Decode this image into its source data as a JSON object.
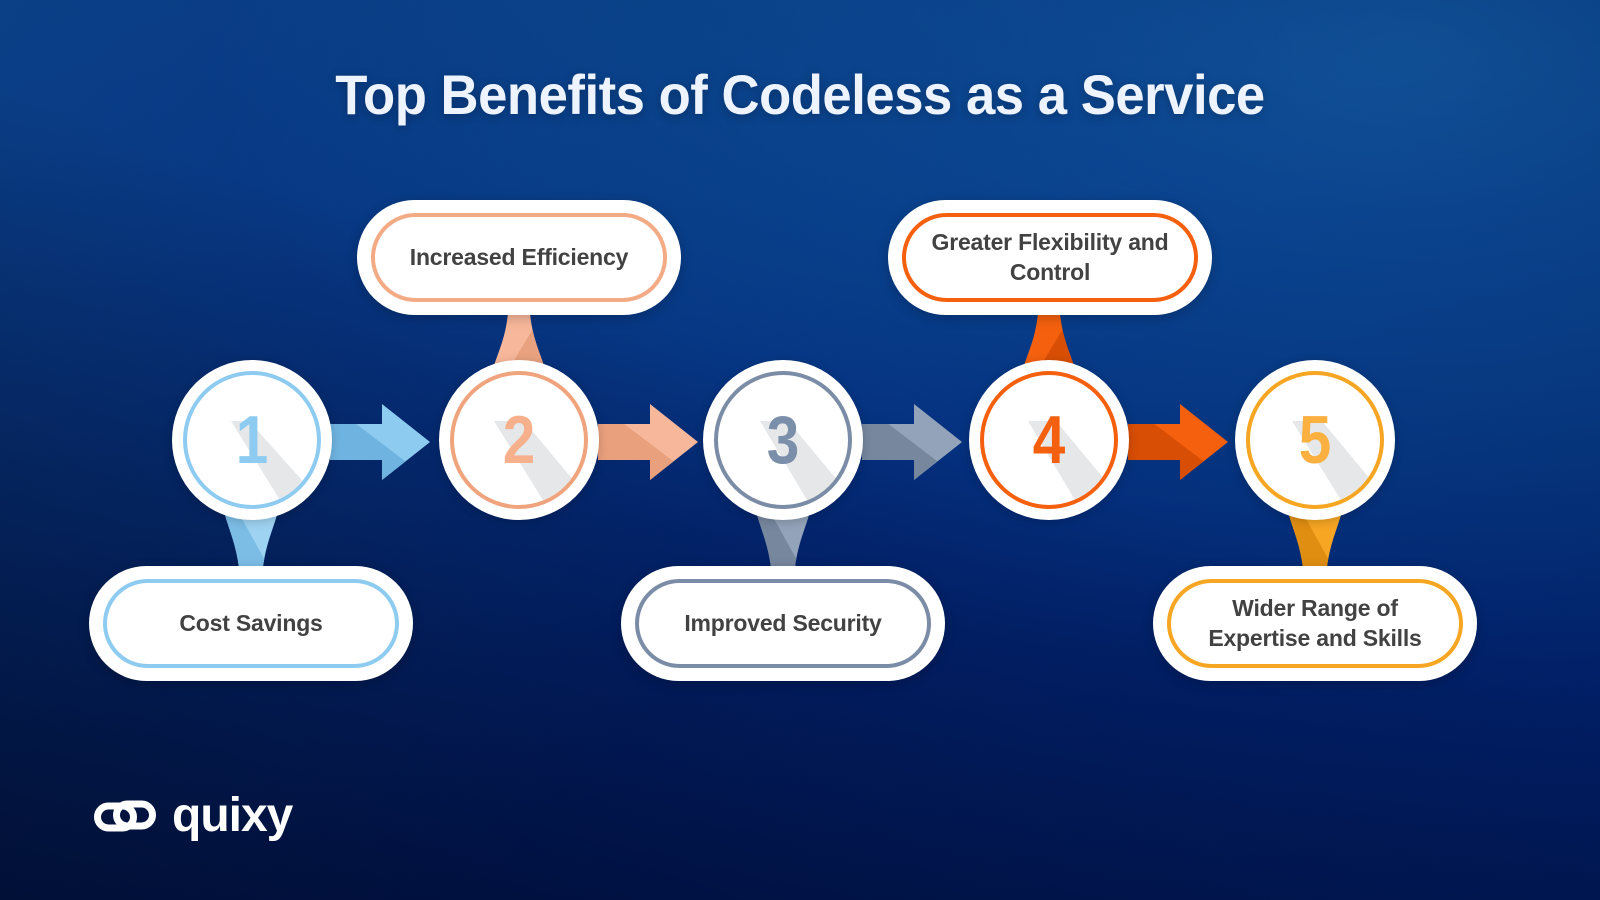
{
  "page": {
    "title": "Top Benefits of Codeless as a Service",
    "background_color_dark": "#011041",
    "background_color_light": "#0d4a8c",
    "title_color": "#eef4ff"
  },
  "brand": {
    "name": "quixy",
    "logo_icon": "infinity-loops-icon",
    "color": "#ffffff"
  },
  "steps": [
    {
      "number": "1",
      "label": "Cost Savings",
      "position": "below",
      "color": "#8ecbf0",
      "number_color": "#8ecbf0",
      "arrow_color": "#8ecbf0",
      "arrow_shade": "#6fb4e0"
    },
    {
      "number": "2",
      "label": "Increased Efficiency",
      "position": "above",
      "color": "#f3ab85",
      "number_color": "#f7b08c",
      "arrow_color": "#f6b293",
      "arrow_shade": "#e59b78"
    },
    {
      "number": "3",
      "label": "Improved Security",
      "position": "below",
      "color": "#7b8da6",
      "number_color": "#7b8fab",
      "arrow_color": "#8b9bb2",
      "arrow_shade": "#74859c"
    },
    {
      "number": "4",
      "label": "Greater Flexibility and Control",
      "position": "above",
      "color": "#f4600e",
      "number_color": "#f4600e",
      "arrow_color": "#f4600e",
      "arrow_shade": "#dd4f06"
    },
    {
      "number": "5",
      "label": "Wider Range of Expertise and Skills",
      "position": "below",
      "color": "#f6a623",
      "number_color": "#fbb040",
      "arrow_color": "#f6a623",
      "arrow_shade": "#e09010"
    }
  ],
  "arrows": [
    {
      "name": "arrow-1-to-2"
    },
    {
      "name": "arrow-2-to-3"
    },
    {
      "name": "arrow-3-to-4"
    },
    {
      "name": "arrow-4-to-5"
    }
  ]
}
